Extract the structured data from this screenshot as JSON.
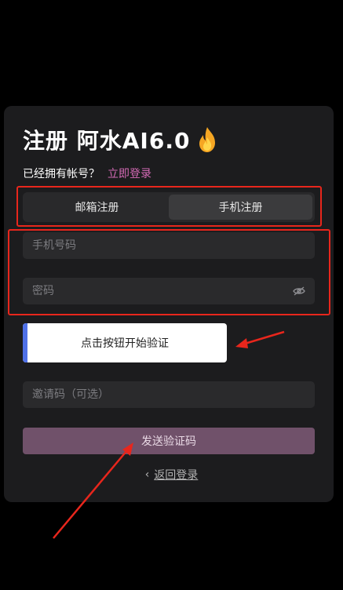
{
  "header": {
    "title": "注册 阿水AI6.0",
    "fire_icon": "fire-icon"
  },
  "login_prompt": {
    "question": "已经拥有帐号？",
    "link_label": "立即登录"
  },
  "tabs": [
    {
      "label": "邮箱注册",
      "active": false
    },
    {
      "label": "手机注册",
      "active": true
    }
  ],
  "form": {
    "phone_placeholder": "手机号码",
    "password_placeholder": "密码",
    "password_toggle_icon": "eye-off-icon",
    "captcha_label": "点击按钮开始验证",
    "invite_placeholder": "邀请码（可选）",
    "send_code_label": "发送验证码"
  },
  "footer": {
    "back_icon": "chevron-left-icon",
    "back_label": "返回登录"
  },
  "colors": {
    "background": "#000000",
    "card": "#1c1c1e",
    "accent_link": "#d46ab5",
    "send_button": "#70516a",
    "captcha_bar": "#4f71e8",
    "annotation_red": "#e8261c"
  }
}
